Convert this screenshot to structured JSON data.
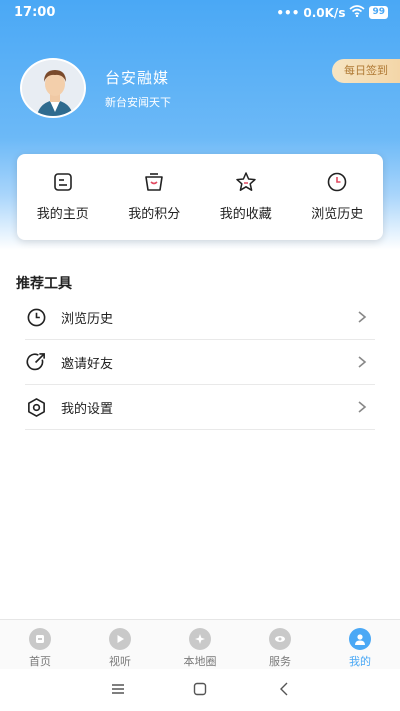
{
  "status_bar": {
    "time": "17:00",
    "network_speed": "0.0K/s",
    "battery": "99"
  },
  "profile": {
    "name": "台安融媒",
    "subtitle": "新台安闻天下",
    "signin_label": "每日签到"
  },
  "quick_actions": [
    {
      "label": "我的主页",
      "icon": "home-page-icon"
    },
    {
      "label": "我的积分",
      "icon": "points-bag-icon"
    },
    {
      "label": "我的收藏",
      "icon": "star-icon"
    },
    {
      "label": "浏览历史",
      "icon": "clock-icon"
    }
  ],
  "tools": {
    "title": "推荐工具",
    "items": [
      {
        "label": "浏览历史",
        "icon": "clock-icon"
      },
      {
        "label": "邀请好友",
        "icon": "share-arrow-icon"
      },
      {
        "label": "我的设置",
        "icon": "settings-hexagon-icon"
      }
    ]
  },
  "tabbar": [
    {
      "label": "首页",
      "icon": "home-icon",
      "active": false
    },
    {
      "label": "视听",
      "icon": "play-icon",
      "active": false
    },
    {
      "label": "本地圈",
      "icon": "compass-icon",
      "active": false
    },
    {
      "label": "服务",
      "icon": "service-icon",
      "active": false
    },
    {
      "label": "我的",
      "icon": "user-icon",
      "active": true
    }
  ],
  "colors": {
    "accent": "#4aa8f5",
    "signin_text": "#b07a35"
  }
}
